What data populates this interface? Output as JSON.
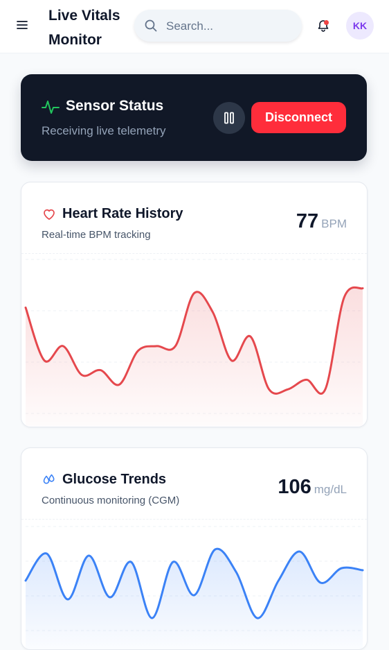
{
  "header": {
    "title": "Live Vitals Monitor",
    "search_placeholder": "Search...",
    "avatar_initials": "KK",
    "notification_dot_color": "#ef4444"
  },
  "sensor": {
    "title": "Sensor Status",
    "subtitle": "Receiving live telemetry",
    "pause_icon": "pause-icon",
    "disconnect_label": "Disconnect"
  },
  "heart_rate": {
    "title": "Heart Rate History",
    "subtitle": "Real-time BPM tracking",
    "value": "77",
    "unit": "BPM",
    "icon": "heart-icon",
    "color": "#e5484d"
  },
  "glucose": {
    "title": "Glucose Trends",
    "subtitle": "Continuous monitoring (CGM)",
    "value": "106",
    "unit": "mg/dL",
    "icon": "droplet-icon",
    "color": "#3b82f6"
  },
  "chart_data": [
    {
      "type": "line",
      "series": [
        {
          "values": [
            80,
            69,
            72,
            66,
            67,
            64,
            71,
            72,
            72,
            83,
            79,
            69,
            74,
            63,
            63,
            65,
            63,
            82,
            84
          ]
        }
      ],
      "ylim": [
        58,
        90
      ]
    },
    {
      "type": "line",
      "series": [
        {
          "values": [
            104,
            117,
            95,
            116,
            96,
            113,
            86,
            113,
            97,
            119,
            108,
            86,
            104,
            118,
            103,
            110,
            109
          ]
        }
      ],
      "ylim": [
        80,
        130
      ]
    }
  ]
}
